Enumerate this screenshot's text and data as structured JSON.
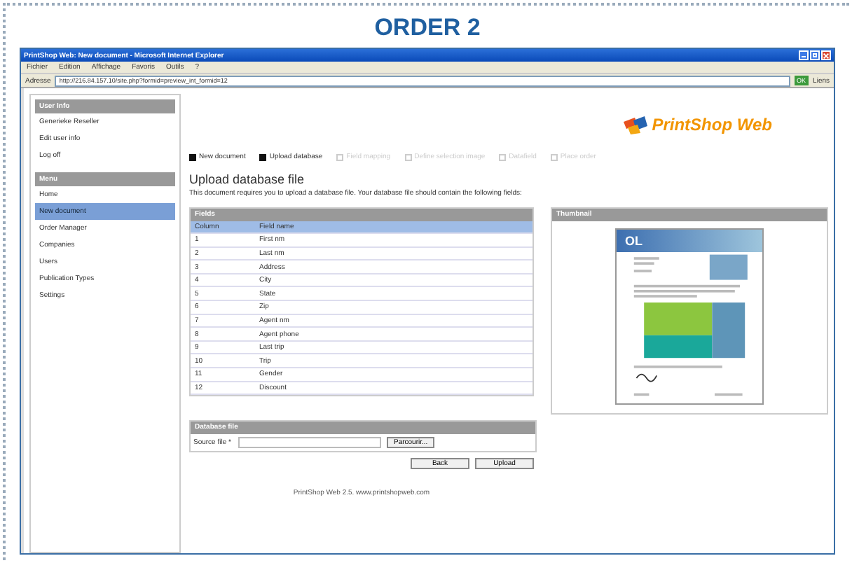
{
  "heading": "ORDER 2",
  "window": {
    "title": "PrintShop Web: New document - Microsoft Internet Explorer"
  },
  "menu_bar": [
    "Fichier",
    "Edition",
    "Affichage",
    "Favoris",
    "Outils",
    "?"
  ],
  "address_bar": {
    "label": "Adresse",
    "value": "http://216.84.157.10/site.php?formid=preview_int_formid=12",
    "go": "OK",
    "links": "Liens"
  },
  "logo": {
    "text": "PrintShop Web"
  },
  "sidebar": [
    {
      "title": "User Info",
      "items": [
        {
          "label": "Generieke Reseller",
          "selected": false
        },
        {
          "label": "Edit user info",
          "selected": false
        },
        {
          "label": "Log off",
          "selected": false
        }
      ]
    },
    {
      "title": "Menu",
      "items": [
        {
          "label": "Home",
          "selected": false
        },
        {
          "label": "New document",
          "selected": true
        },
        {
          "label": "Order Manager",
          "selected": false
        },
        {
          "label": "Companies",
          "selected": false
        },
        {
          "label": "Users",
          "selected": false
        },
        {
          "label": "Publication Types",
          "selected": false
        },
        {
          "label": "Settings",
          "selected": false
        }
      ]
    }
  ],
  "steps": [
    {
      "label": "New document",
      "completed": true
    },
    {
      "label": "Upload database",
      "completed": true
    },
    {
      "label": "Field mapping",
      "completed": false
    },
    {
      "label": "Define selection image",
      "completed": false
    },
    {
      "label": "Datafield",
      "completed": false
    },
    {
      "label": "Place order",
      "completed": false
    }
  ],
  "page_title": "Upload database file",
  "description": "This document requires you to upload a database file. Your database file should contain the following fields:",
  "fields_table": {
    "title": "Fields",
    "columns": [
      "Column",
      "Field name"
    ],
    "rows": [
      [
        "1",
        "First nm"
      ],
      [
        "2",
        "Last nm"
      ],
      [
        "3",
        "Address"
      ],
      [
        "4",
        "City"
      ],
      [
        "5",
        "State"
      ],
      [
        "6",
        "Zip"
      ],
      [
        "7",
        "Agent nm"
      ],
      [
        "8",
        "Agent phone"
      ],
      [
        "9",
        "Last trip"
      ],
      [
        "10",
        "Trip"
      ],
      [
        "11",
        "Gender"
      ],
      [
        "12",
        "Discount"
      ]
    ]
  },
  "thumbnail": {
    "title": "Thumbnail",
    "doc_heading": "OL"
  },
  "database_file": {
    "title": "Database file",
    "label": "Source file *",
    "browse": "Parcourir..."
  },
  "buttons": [
    "Back",
    "Upload"
  ],
  "footer": "PrintShop Web 2.5. www.printshopweb.com"
}
